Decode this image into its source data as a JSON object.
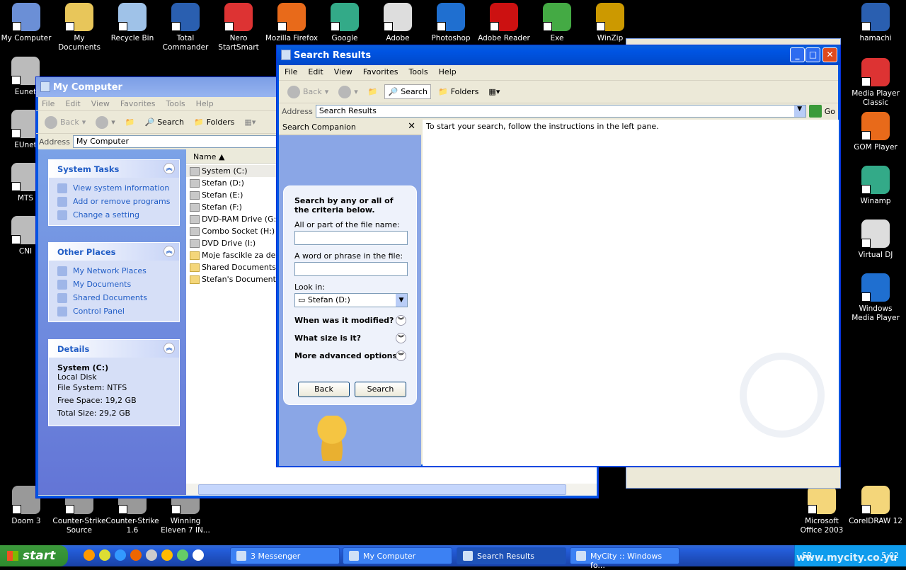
{
  "desktop": {
    "top_icons": [
      "My Computer",
      "My Documents",
      "Recycle Bin",
      "Total Commander",
      "Nero StartSmart",
      "Mozilla Firefox",
      "Google",
      "Adobe",
      "Photoshop",
      "Adobe Reader",
      "Exe",
      "WinZip"
    ],
    "right_icons": [
      "hamachi",
      "Media Player Classic",
      "GOM Player",
      "Winamp",
      "Virtual DJ",
      "Windows Media Player"
    ],
    "left_icons": [
      "Eunet",
      "EUnet",
      "MTS",
      "CNI"
    ],
    "bottom_icons": [
      "Doom 3",
      "Counter-Strike Source",
      "Counter-Strike 1.6",
      "Winning Eleven 7 IN..."
    ],
    "bottom_right_icons": [
      "Microsoft Office 2003",
      "CorelDRAW 12"
    ],
    "watermark": "www.mycity.co.yu"
  },
  "my_computer": {
    "title": "My Computer",
    "menu": [
      "File",
      "Edit",
      "View",
      "Favorites",
      "Tools",
      "Help"
    ],
    "toolbar": {
      "back": "Back",
      "search": "Search",
      "folders": "Folders"
    },
    "address_label": "Address",
    "address": "My Computer",
    "system_tasks": {
      "title": "System Tasks",
      "items": [
        "View system information",
        "Add or remove programs",
        "Change a setting"
      ]
    },
    "other_places": {
      "title": "Other Places",
      "items": [
        "My Network Places",
        "My Documents",
        "Shared Documents",
        "Control Panel"
      ]
    },
    "details": {
      "title": "Details",
      "name": "System (C:)",
      "type": "Local Disk",
      "fs": "File System: NTFS",
      "free": "Free Space: 19,2 GB",
      "total": "Total Size: 29,2 GB"
    },
    "column": "Name",
    "files": [
      "System (C:)",
      "Stefan (D:)",
      "Stefan (E:)",
      "Stefan (F:)",
      "DVD-RAM Drive (G:)",
      "Combo Socket (H:)",
      "DVD Drive (I:)",
      "Moje fascikle za deljenje",
      "Shared Documents",
      "Stefan's Documents"
    ]
  },
  "search": {
    "title": "Search Results",
    "menu": [
      "File",
      "Edit",
      "View",
      "Favorites",
      "Tools",
      "Help"
    ],
    "toolbar": {
      "back": "Back",
      "search": "Search",
      "folders": "Folders"
    },
    "address_label": "Address",
    "address": "Search Results",
    "go": "Go",
    "companion": "Search Companion",
    "message": "To start your search, follow the instructions in the left pane.",
    "criteria": "Search by any or all of the criteria below.",
    "name_label": "All or part of the file name:",
    "name_value": "",
    "phrase_label": "A word or phrase in the file:",
    "phrase_value": "",
    "lookin_label": "Look in:",
    "lookin_value": "Stefan (D:)",
    "modified": "When was it modified?",
    "size": "What size is it?",
    "advanced": "More advanced options",
    "back_btn": "Back",
    "search_btn": "Search"
  },
  "taskbar": {
    "start": "start",
    "tasks": [
      "3 Messenger",
      "My Computer",
      "Search Results",
      "MyCity :: Windows fo..."
    ],
    "lang": "SR",
    "clock": "5:02"
  }
}
